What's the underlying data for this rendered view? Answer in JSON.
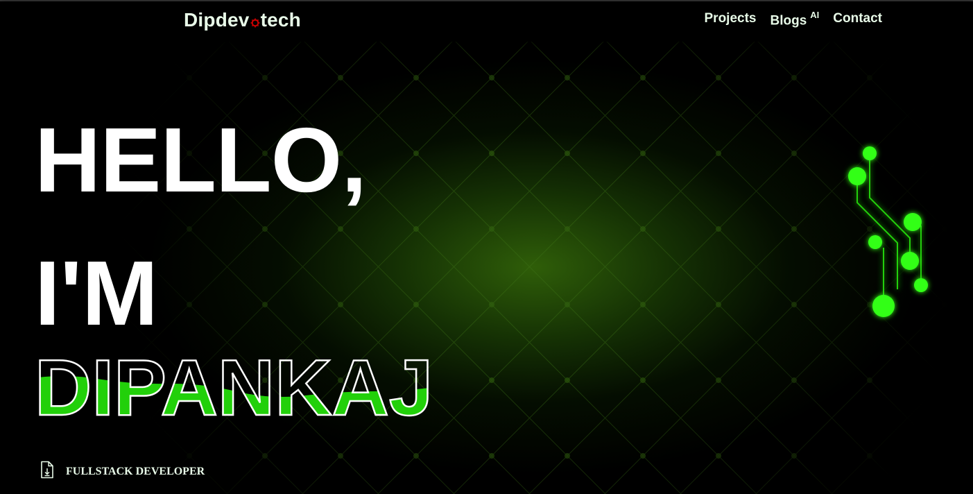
{
  "brand": {
    "text_before": "Dipdev",
    "text_after": "tech",
    "icon": "gear-icon"
  },
  "nav": {
    "items": [
      {
        "label": "Projects",
        "superscript": ""
      },
      {
        "label": "Blogs",
        "superscript": "AI"
      },
      {
        "label": "Contact",
        "superscript": ""
      }
    ]
  },
  "hero": {
    "line1": "HELLO,",
    "line2": "I'M",
    "name": "DIPANKAJ",
    "role": "FULLSTACK DEVELOPER",
    "role_icon": "file-download-icon"
  },
  "colors": {
    "accent_green": "#22d00a",
    "background": "#000000",
    "gear_red": "#cc0000",
    "text_light": "#e9fbe9"
  }
}
